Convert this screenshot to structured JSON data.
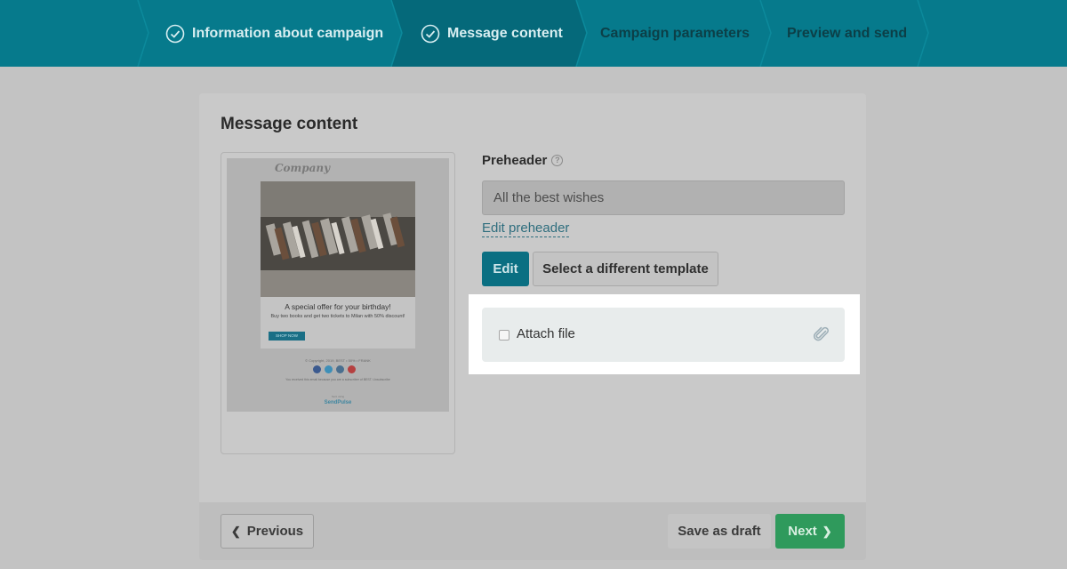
{
  "stepper": {
    "steps": [
      {
        "label": "Information about campaign",
        "state": "done"
      },
      {
        "label": "Message content",
        "state": "current"
      },
      {
        "label": "Campaign parameters",
        "state": "pending"
      },
      {
        "label": "Preview and send",
        "state": "pending"
      }
    ]
  },
  "card": {
    "title": "Message content"
  },
  "preview": {
    "logo": "Company",
    "headline": "A special offer for your birthday!",
    "subtext": "Buy two books and get two tickets to Milan with 50% discount!",
    "button": "SHOP NOW",
    "copyright": "© Copyright, 2019, BEST • 50% • FRANK",
    "note": "You received this email because you are a subscriber of BEST. Unsubscribe",
    "powered": "Sent using",
    "brand": "SendPulse"
  },
  "form": {
    "preheader_label": "Preheader",
    "preheader_value": "All the best wishes",
    "edit_preheader": "Edit preheader",
    "edit_button": "Edit",
    "template_button": "Select a different template",
    "attach_label": "Attach file"
  },
  "footer": {
    "previous": "Previous",
    "save_draft": "Save as draft",
    "next": "Next"
  },
  "colors": {
    "stepper_bg": "#067a8c",
    "current_step": "#05697a",
    "next_button": "#2f9a5c",
    "edit_button": "#0a6f82"
  }
}
